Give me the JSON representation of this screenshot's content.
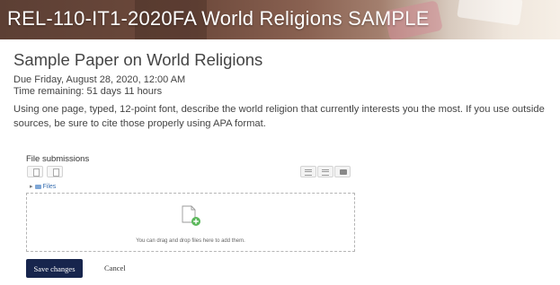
{
  "banner": {
    "course_title": "REL-110-IT1-2020FA World Religions SAMPLE"
  },
  "assignment": {
    "title": "Sample Paper on World Religions",
    "due": "Due Friday, August 28, 2020, 12:00 AM",
    "time_remaining": "Time remaining: 51 days 11 hours",
    "description": "Using one page, typed, 12-point font, describe the world religion that currently interests you the most. If you use outside sources, be sure to cite those properly using APA format."
  },
  "file_submissions": {
    "label": "File submissions",
    "toolbar_left": [
      "add-file-icon",
      "create-folder-icon"
    ],
    "toolbar_right": [
      "icon-view-icon",
      "list-view-icon",
      "tree-view-icon"
    ],
    "files_label": "Files",
    "dropzone_text": "You can drag and drop files here to add them."
  },
  "actions": {
    "save_label": "Save changes",
    "cancel_label": "Cancel"
  },
  "colors": {
    "primary_button": "#17254d",
    "folder_blue": "#7fa7d6",
    "add_green": "#5cb85c"
  }
}
